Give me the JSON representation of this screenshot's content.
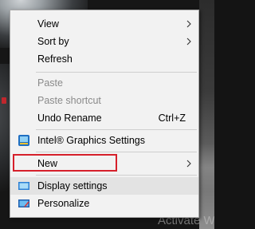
{
  "menu": {
    "view": "View",
    "sort_by": "Sort by",
    "refresh": "Refresh",
    "paste": "Paste",
    "paste_shortcut": "Paste shortcut",
    "undo_rename": "Undo Rename",
    "undo_rename_shortcut": "Ctrl+Z",
    "intel_graphics": "Intel® Graphics Settings",
    "new": "New",
    "display_settings": "Display settings",
    "personalize": "Personalize"
  },
  "watermark": "Activate Wi",
  "colors": {
    "menu_background": "#f2f2f2",
    "hover_background": "#e3e3e3",
    "disabled_text": "#8a8a8a",
    "highlight_border": "#d6202b"
  },
  "icons": {
    "intel_graphics": "intel-graphics-icon",
    "display_settings": "display-monitor-icon",
    "personalize": "personalize-screen-icon",
    "submenu": "chevron-right-icon"
  }
}
